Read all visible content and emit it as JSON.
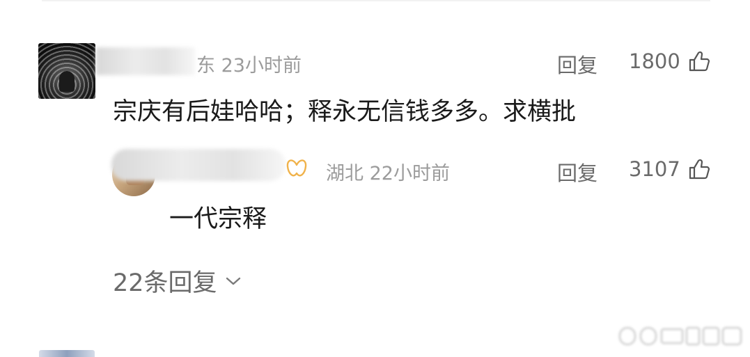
{
  "comment": {
    "location": "东",
    "time": "23小时前",
    "reply_label": "回复",
    "likes": "1800",
    "text": "宗庆有后娃哈哈；释永无信钱多多。求横批"
  },
  "reply": {
    "location": "湖北",
    "time": "22小时前",
    "reply_label": "回复",
    "likes": "3107",
    "text": "一代宗释"
  },
  "more_replies_label": "22条回复",
  "icons": {
    "like": "thumbs-up-icon",
    "badge": "butterfly-badge-icon",
    "expand": "chevron-down-icon"
  },
  "colors": {
    "meta": "#9b9b9b",
    "text": "#1a1a1a",
    "badge": "#f0b24a"
  }
}
